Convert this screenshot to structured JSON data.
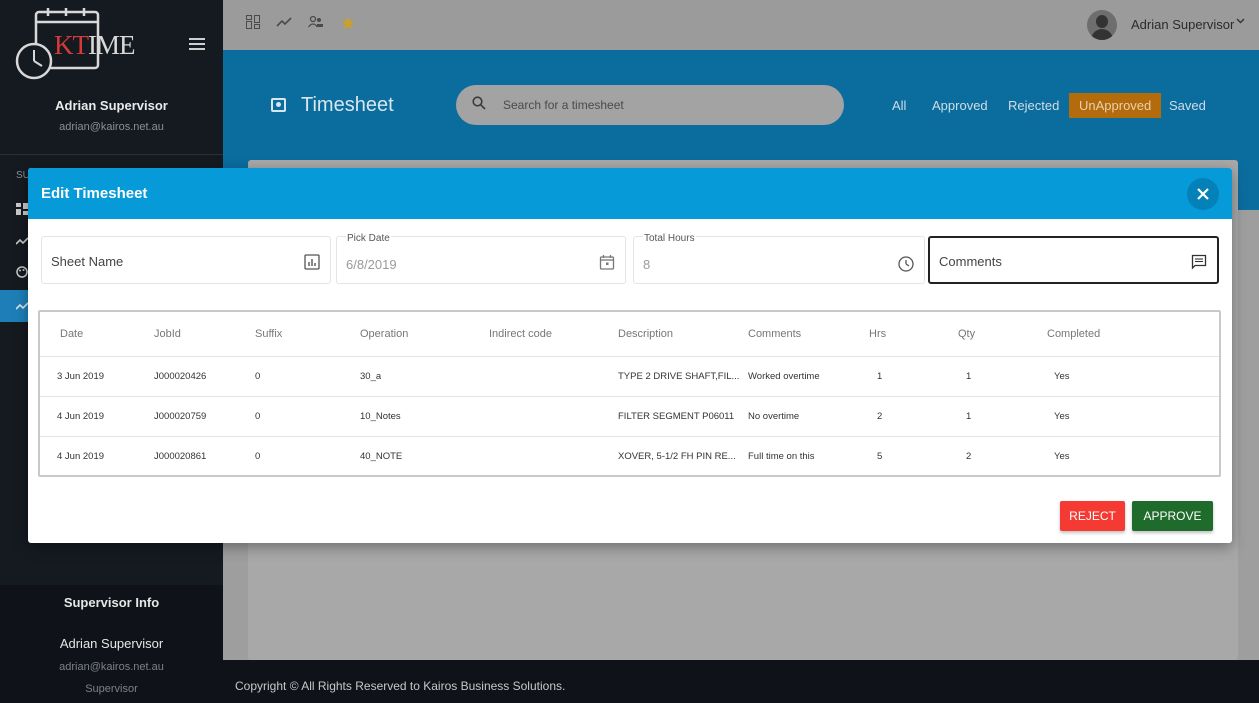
{
  "app": {
    "logo_text_kt": "KT",
    "logo_text_ime": "IME"
  },
  "sidebar": {
    "user_name": "Adrian Supervisor",
    "user_email": "adrian@kairos.net.au",
    "section_label": "SU",
    "supervisor_info": {
      "title": "Supervisor Info",
      "name": "Adrian Supervisor",
      "email": "adrian@kairos.net.au",
      "role": "Supervisor"
    }
  },
  "topbar": {
    "user_name": "Adrian Supervisor",
    "icons": [
      "dashboard-icon",
      "trend-icon",
      "users-icon",
      "star-icon"
    ]
  },
  "header": {
    "title": "Timesheet",
    "search_placeholder": "Search for a timesheet",
    "filters": [
      "All",
      "Approved",
      "Rejected",
      "UnApproved",
      "Saved"
    ],
    "active_filter": "UnApproved"
  },
  "footer": {
    "text": "Copyright © All Rights Reserved to Kairos Business Solutions."
  },
  "modal": {
    "title": "Edit Timesheet",
    "fields": {
      "sheet_name": {
        "placeholder": "Sheet Name"
      },
      "pick_date": {
        "label": "Pick Date",
        "value": "6/8/2019"
      },
      "total_hours": {
        "label": "Total Hours",
        "value": "8"
      },
      "comments": {
        "placeholder": "Comments"
      }
    },
    "table": {
      "columns": [
        "Date",
        "JobId",
        "Suffix",
        "Operation",
        "Indirect code",
        "Description",
        "Comments",
        "Hrs",
        "Qty",
        "Completed"
      ],
      "rows": [
        [
          "3 Jun 2019",
          "J000020426",
          "0",
          "30_a",
          "",
          "TYPE 2 DRIVE SHAFT,FIL...",
          "Worked overtime",
          "1",
          "1",
          "Yes"
        ],
        [
          "4 Jun 2019",
          "J000020759",
          "0",
          "10_Notes",
          "",
          "FILTER SEGMENT P06011",
          "No overtime",
          "2",
          "1",
          "Yes"
        ],
        [
          "4 Jun 2019",
          "J000020861",
          "0",
          "40_NOTE",
          "",
          "XOVER, 5-1/2 FH PIN RE...",
          "Full time on this",
          "5",
          "2",
          "Yes"
        ]
      ]
    },
    "buttons": {
      "reject": "REJECT",
      "approve": "APPROVE"
    }
  }
}
